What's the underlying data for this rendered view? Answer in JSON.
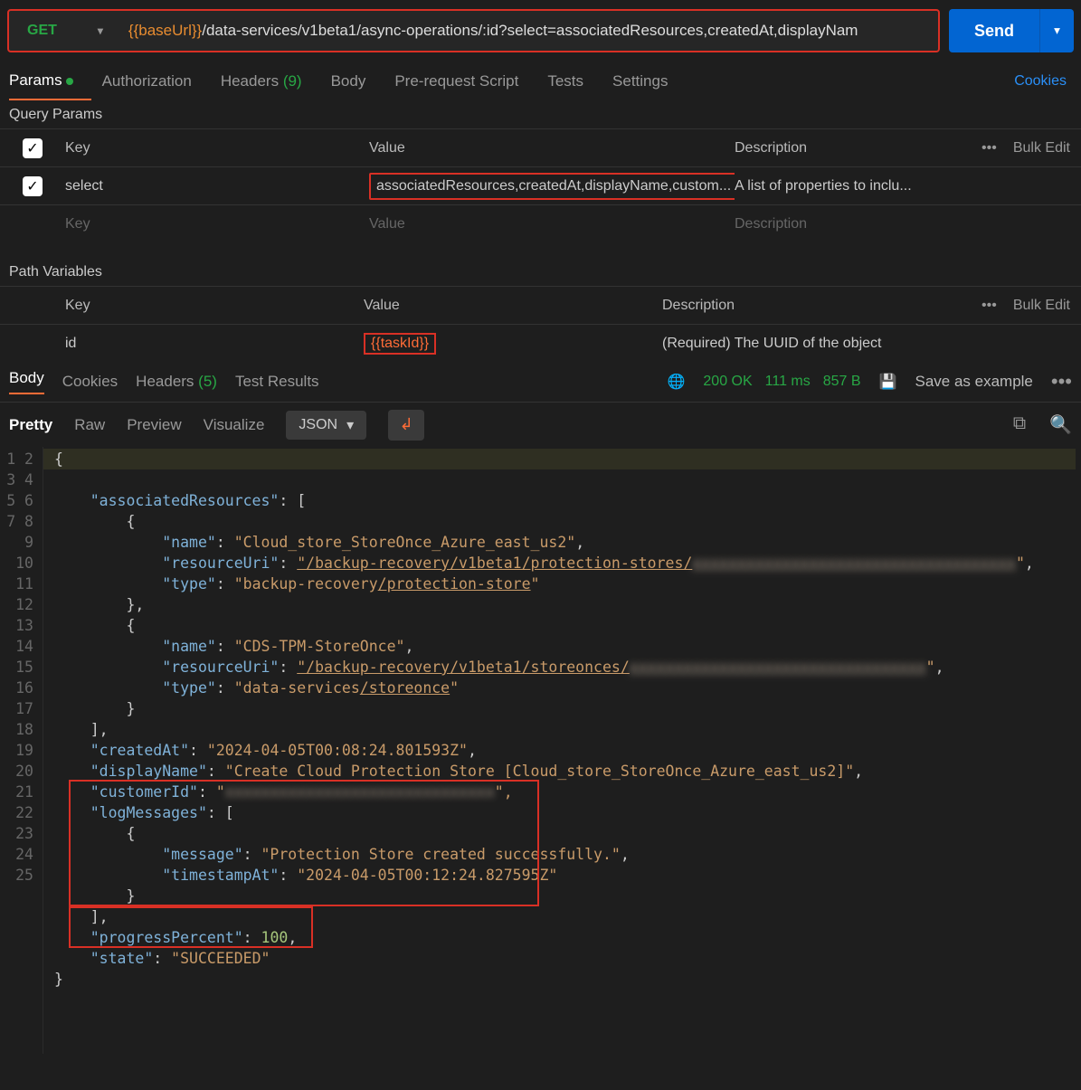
{
  "request": {
    "method": "GET",
    "url_variable": "{{baseUrl}}",
    "url_path": "/data-services/v1beta1/async-operations/:id?select=associatedResources,createdAt,displayNam",
    "send_label": "Send"
  },
  "request_tabs": {
    "params": "Params",
    "authorization": "Authorization",
    "headers": "Headers",
    "headers_count": "(9)",
    "body": "Body",
    "pre_request": "Pre-request Script",
    "tests": "Tests",
    "settings": "Settings",
    "cookies": "Cookies"
  },
  "query_params": {
    "title": "Query Params",
    "headers": {
      "key": "Key",
      "value": "Value",
      "description": "Description",
      "bulk_edit": "Bulk Edit",
      "more": "•••"
    },
    "row1": {
      "key": "select",
      "value": "associatedResources,createdAt,displayName,custom...",
      "description": "A list of properties to inclu..."
    },
    "placeholder": {
      "key": "Key",
      "value": "Value",
      "description": "Description"
    }
  },
  "path_variables": {
    "title": "Path Variables",
    "headers": {
      "key": "Key",
      "value": "Value",
      "description": "Description",
      "bulk_edit": "Bulk Edit",
      "more": "•••"
    },
    "row1": {
      "key": "id",
      "value": "{{taskId}}",
      "description": "(Required) The UUID of the object"
    }
  },
  "response_tabs": {
    "body": "Body",
    "cookies": "Cookies",
    "headers": "Headers",
    "headers_count": "(5)",
    "test_results": "Test Results",
    "status": "200 OK",
    "time": "111 ms",
    "size": "857 B",
    "save_example": "Save as example"
  },
  "view_tabs": {
    "pretty": "Pretty",
    "raw": "Raw",
    "preview": "Preview",
    "visualize": "Visualize",
    "format": "JSON"
  },
  "code": {
    "l1": "{",
    "l2_k": "\"associatedResources\"",
    "l2_p": ": [",
    "l3": "{",
    "l4_k": "\"name\"",
    "l4_v": "\"Cloud_store_StoreOnce_Azure_east_us2\"",
    "l5_k": "\"resourceUri\"",
    "l5_v": "\"/backup-recovery/v1beta1/protection-stores/",
    "l5_blur": "xxxxxxxxxxxxxxxxxxxxxxxxxxxxxxxxxxxx",
    "l5_end": "\"",
    "l6_k": "\"type\"",
    "l6_v1": "\"backup-recovery",
    "l6_v2": "/protection-store",
    "l6_end": "\"",
    "l7": "},",
    "l8": "{",
    "l9_k": "\"name\"",
    "l9_v": "\"CDS-TPM-StoreOnce\"",
    "l10_k": "\"resourceUri\"",
    "l10_v": "\"/backup-recovery/v1beta1/storeonces/",
    "l10_blur": "xxxxxxxxxxxxxxxxxxxxxxxxxxxxxxxxx",
    "l10_end": "\"",
    "l11_k": "\"type\"",
    "l11_v1": "\"data-services",
    "l11_v2": "/storeonce",
    "l11_end": "\"",
    "l12": "}",
    "l13": "],",
    "l14_k": "\"createdAt\"",
    "l14_v": "\"2024-04-05T00:08:24.801593Z\"",
    "l15_k": "\"displayName\"",
    "l15_v": "\"Create Cloud Protection Store [Cloud_store_StoreOnce_Azure_east_us2]\"",
    "l16_k": "\"customerId\"",
    "l16_blur": "xxxxxxxxxxxxxxxxxxxxxxxxxxxxxx",
    "l16_end": "\",",
    "l17_k": "\"logMessages\"",
    "l17_p": ": [",
    "l18": "{",
    "l19_k": "\"message\"",
    "l19_v": "\"Protection Store created successfully.\"",
    "l20_k": "\"timestampAt\"",
    "l20_v": "\"2024-04-05T00:12:24.827595Z\"",
    "l21": "}",
    "l22": "],",
    "l23_k": "\"progressPercent\"",
    "l23_v": "100",
    "l24_k": "\"state\"",
    "l24_v": "\"SUCCEEDED\"",
    "l25": "}"
  }
}
